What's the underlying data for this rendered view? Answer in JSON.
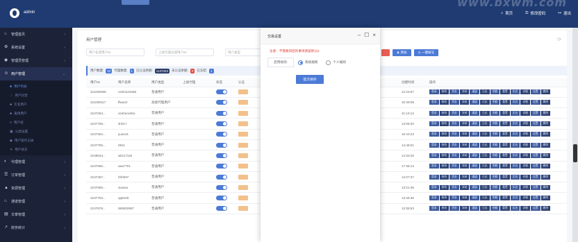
{
  "header": {
    "user": "admin",
    "watermark": "www.bxwm.com",
    "links": [
      {
        "icon": "home-icon",
        "label": "首页"
      },
      {
        "icon": "key-icon",
        "label": "修改密码"
      },
      {
        "icon": "logout-icon",
        "label": "退出"
      }
    ]
  },
  "sidebar": {
    "items": [
      {
        "icon": "⌂",
        "label": "管理首页"
      },
      {
        "icon": "⚙",
        "label": "系统设置"
      },
      {
        "icon": "◉",
        "label": "管理员管理"
      },
      {
        "icon": "☺",
        "label": "用户管理"
      }
    ],
    "sub_items": [
      {
        "icon": "♣",
        "label": "用户列表"
      },
      {
        "icon": "♢",
        "label": "用户封禁"
      },
      {
        "icon": "♣",
        "label": "实名用户"
      },
      {
        "icon": "♣",
        "label": "邀请用户"
      },
      {
        "icon": "≡",
        "label": "用户组"
      },
      {
        "icon": "▣",
        "label": "分类设置"
      },
      {
        "icon": "◆",
        "label": "用户操作记录"
      },
      {
        "icon": "✦",
        "label": "用户收支"
      }
    ],
    "bottom_items": [
      {
        "icon": "◐",
        "label": "代理管理"
      },
      {
        "icon": "☰",
        "label": "订单管理"
      },
      {
        "icon": "▲",
        "label": "资源管理"
      },
      {
        "icon": "⌂",
        "label": "通道管理"
      },
      {
        "icon": "▤",
        "label": "文章管理"
      },
      {
        "icon": "↗",
        "label": "财务统计"
      }
    ]
  },
  "panel": {
    "title": "用户管理",
    "filters": [
      "用户名或用户ID",
      "上级代理号或用户ID",
      "用户类型"
    ],
    "buttons": {
      "delete": "",
      "add": "添加",
      "add_icon": "person-icon",
      "oneclick": "一键解冻"
    },
    "stats": [
      {
        "label": "用户数量:",
        "value": "12"
      },
      {
        "label": "代理数量:",
        "value": "1"
      },
      {
        "label": "已认证余额:",
        "value": "1137323"
      },
      {
        "label": "未认证余额:",
        "value": "0"
      },
      {
        "label": "已冻结:",
        "value": "1"
      }
    ]
  },
  "table": {
    "headers": [
      "用户ID",
      "用户名称",
      "用户类型",
      "上级代理",
      "状态",
      "认证",
      "",
      "",
      "",
      "",
      "创建时间",
      "操作"
    ],
    "rows": [
      {
        "id": "211039295",
        "name": "ceshi123456",
        "type": "普通用户",
        "time": "12:23:57"
      },
      {
        "id": "211039117",
        "name": "ffwwzz",
        "type": "高级代理用户",
        "time": "10:49:08"
      },
      {
        "id": "2107294...",
        "name": "cesheceshe",
        "type": "普通用户",
        "time": "21:16:13"
      },
      {
        "id": "2107759...",
        "name": "sh017",
        "type": "普通用户",
        "time": "13:08:20"
      },
      {
        "id": "2107364...",
        "name": "yuan21",
        "type": "普通用户",
        "time": "16:43:23"
      },
      {
        "id": "2107795...",
        "name": "0811",
        "type": "普通用户",
        "time": "14:48:01"
      },
      {
        "id": "2108044...",
        "name": "ab217115",
        "type": "普通用户",
        "time": "14:33:26"
      },
      {
        "id": "2107656...",
        "name": "aaa7701",
        "type": "普通用户",
        "time": "17:36:13"
      },
      {
        "id": "2107267...",
        "name": "hhh007",
        "type": "普通用户",
        "time": "14:07:37"
      },
      {
        "id": "2107659...",
        "name": "xiaowu",
        "type": "普通用户",
        "time": "13:21:36"
      },
      {
        "id": "2107753...",
        "name": "qq8100",
        "type": "普通用户",
        "time": "13:46:36"
      },
      {
        "id": "2107678...",
        "name": "559002867",
        "type": "普通用户",
        "time": "13:35:53"
      }
    ],
    "ops": [
      "登录",
      "修改",
      "资金",
      "冻结",
      "通道",
      "日志",
      "余额",
      "重置",
      "实名",
      "详细",
      "设置",
      "删除"
    ]
  },
  "modal": {
    "title": "交易设置",
    "warning": "注意：不需要风控的事项请留默认0",
    "field_label": "启用规则:",
    "options": [
      "系统规则",
      "个人规则"
    ],
    "submit": "提交保存"
  }
}
